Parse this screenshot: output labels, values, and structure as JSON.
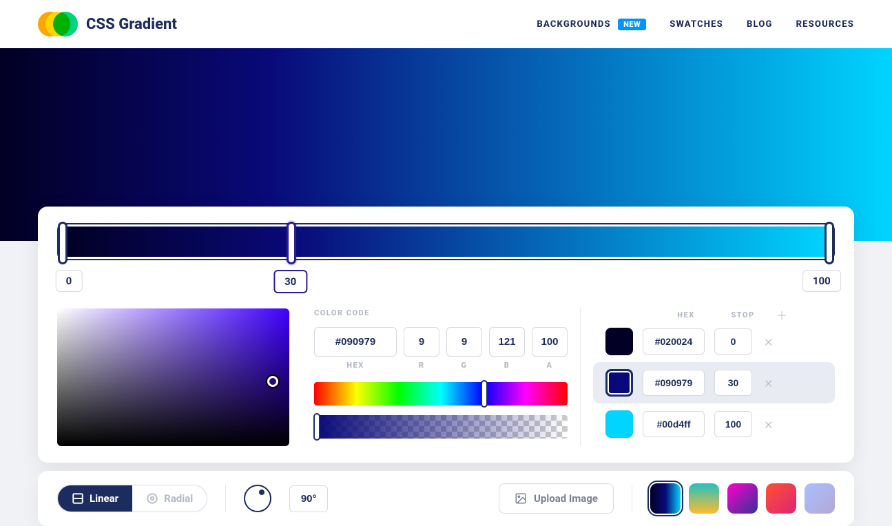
{
  "brand": {
    "name": "CSS Gradient"
  },
  "nav": {
    "backgrounds": "BACKGROUNDS",
    "backgrounds_badge": "NEW",
    "swatches": "SWATCHES",
    "blog": "BLOG",
    "resources": "RESOURCES"
  },
  "gradient": {
    "angle": 90,
    "angle_display": "90°",
    "css": "linear-gradient(90deg, #020024 0%, #090979 30%, #00d4ff 100%)"
  },
  "stops": {
    "header_hex": "HEX",
    "header_stop": "STOP",
    "items": [
      {
        "hex": "#020024",
        "pos": "0",
        "active": false
      },
      {
        "hex": "#090979",
        "pos": "30",
        "active": true
      },
      {
        "hex": "#00d4ff",
        "pos": "100",
        "active": false
      }
    ]
  },
  "color_code": {
    "label": "COLOR CODE",
    "hex": "#090979",
    "r": "9",
    "g": "9",
    "b": "121",
    "a": "100",
    "label_hex": "HEX",
    "label_r": "R",
    "label_g": "G",
    "label_b": "B",
    "label_a": "A"
  },
  "type": {
    "linear": "Linear",
    "radial": "Radial",
    "selected": "linear"
  },
  "upload": {
    "label": "Upload Image"
  },
  "presets": [
    {
      "css": "linear-gradient(90deg,#020024,#090979,#00d4ff)",
      "active": true
    },
    {
      "css": "linear-gradient(180deg,#22c1c3,#fdbb2d)",
      "active": false
    },
    {
      "css": "linear-gradient(135deg,#ff00cc,#333399)",
      "active": false
    },
    {
      "css": "linear-gradient(135deg,#ff512f,#dd2476)",
      "active": false
    },
    {
      "css": "linear-gradient(135deg,#a8c0ff,#b4a7d6)",
      "active": false
    }
  ]
}
